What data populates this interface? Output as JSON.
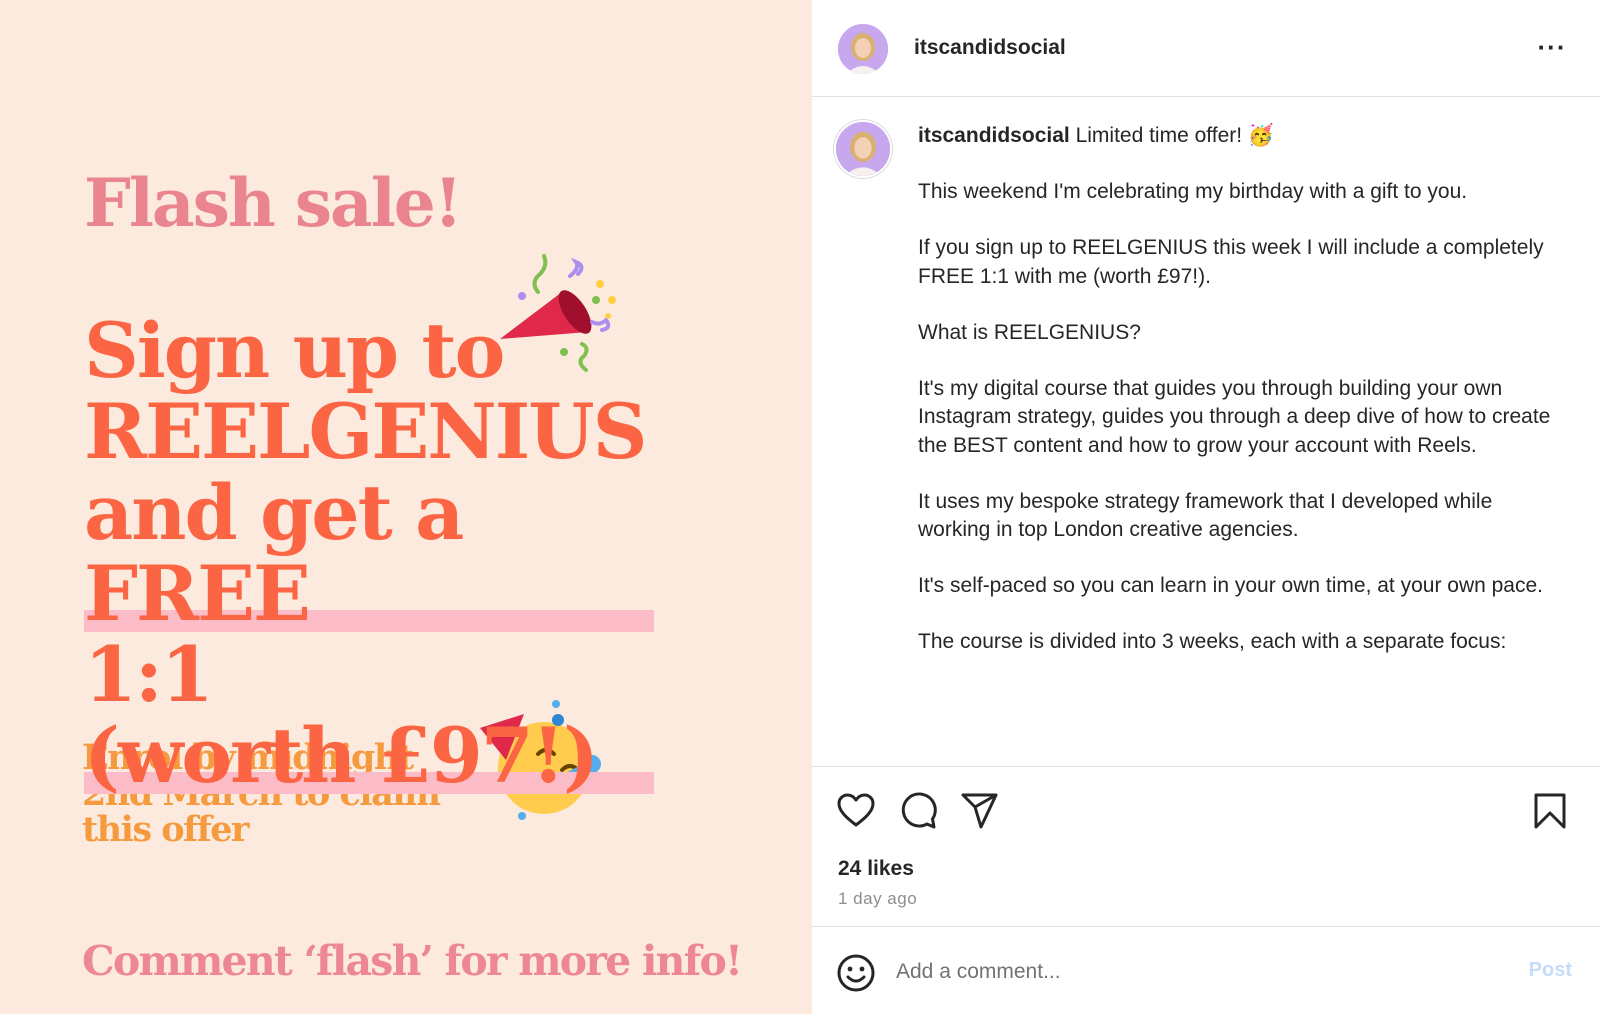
{
  "post_image": {
    "flash_title": "Flash sale!",
    "headline_lines": [
      "Sign up to",
      "REELGENIUS",
      "and get a",
      "FREE",
      "1:1",
      "(worth £97!)"
    ],
    "enrol_lines": [
      "Enrol by midnight",
      "2nd March to claim",
      "this offer"
    ],
    "comment_cta": "Comment ‘flash’ for more info!",
    "colors": {
      "background": "#fbeadd",
      "flash_title": "#ea8590",
      "headline": "#fb6544",
      "highlight": "#fbbcc8",
      "enrol": "#f69a3f",
      "comment_cta": "#ec8793"
    },
    "decorations": [
      "party-popper-icon",
      "partying-face-icon"
    ]
  },
  "header": {
    "username": "itscandidsocial",
    "more_label": "···"
  },
  "caption": {
    "username": "itscandidsocial",
    "first_line": "Limited time offer! 🥳",
    "paragraphs": [
      "This weekend I'm celebrating my birthday with a gift to you.",
      "If you sign up to REELGENIUS this week I will include a completely FREE 1:1 with me (worth £97!).",
      "What is REELGENIUS?",
      "It's my digital course that guides you through building your own Instagram strategy, guides you through a deep dive of how to create the BEST content and how to grow your account with Reels.",
      "It uses my bespoke strategy framework that I developed while working in top London creative agencies.",
      "It's self-paced so you can learn in your own time, at your own pace.",
      "The course is divided into 3 weeks, each with a separate focus:"
    ]
  },
  "actions": {
    "icons": [
      "heart-icon",
      "comment-icon",
      "share-icon",
      "bookmark-icon"
    ],
    "likes": "24 likes",
    "timestamp": "1 day ago"
  },
  "comment_bar": {
    "placeholder": "Add a comment...",
    "post_label": "Post"
  }
}
